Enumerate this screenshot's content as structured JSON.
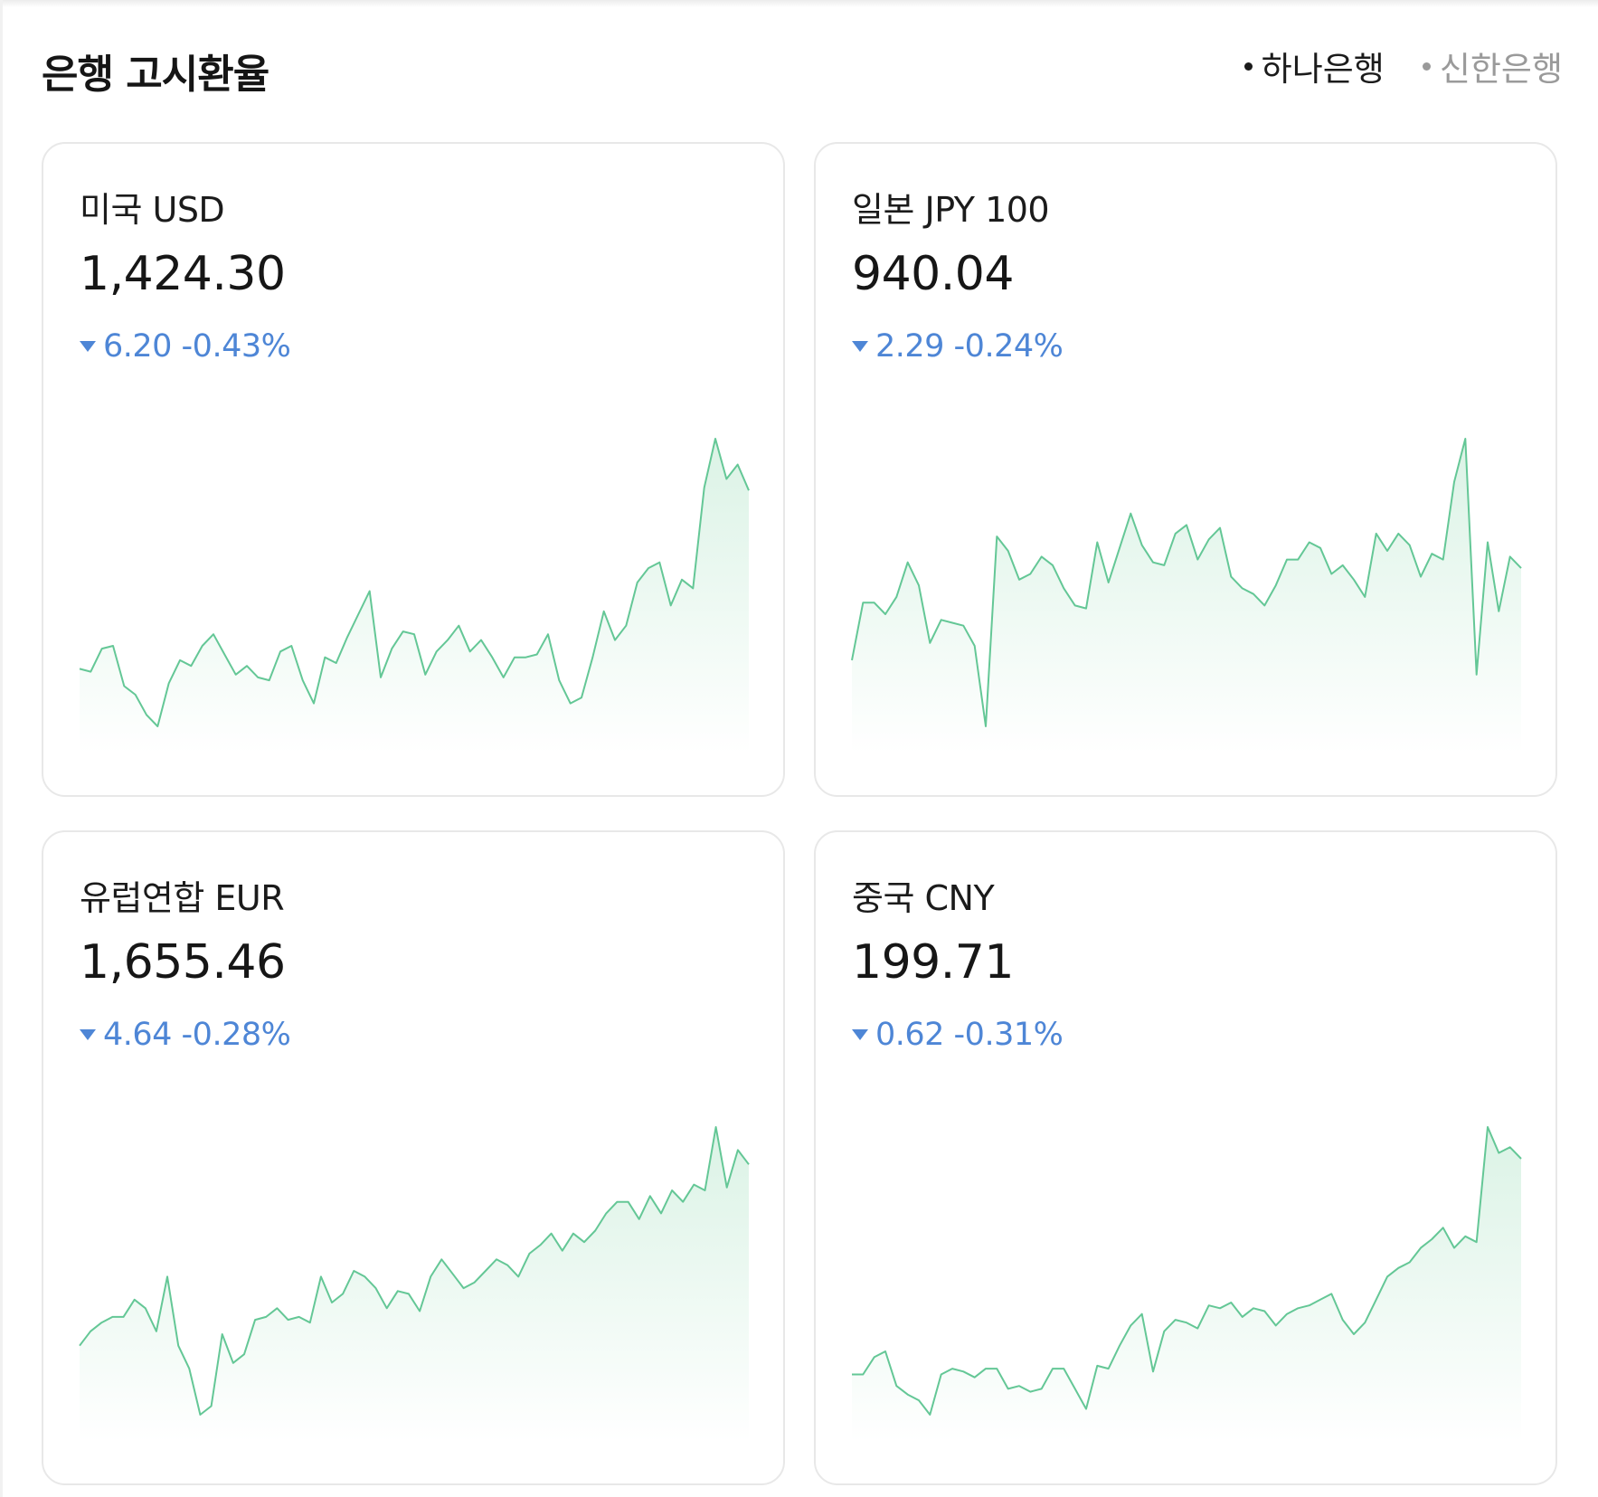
{
  "title": "은행 고시환율",
  "banks": [
    {
      "label": "하나은행",
      "active": true
    },
    {
      "label": "신한은행",
      "active": false
    }
  ],
  "colors": {
    "line": "#64c796",
    "fill": "#d9f2e4",
    "down": "#4e86d6",
    "text": "#1b1b1b",
    "inactive": "#9a9a9a"
  },
  "icons": {
    "bullet": "dot-icon",
    "direction": "triangle-down-icon"
  },
  "cards": [
    {
      "name": "미국 USD",
      "rate": "1,424.30",
      "direction": "down",
      "change": "6.20 -0.43%",
      "chart_data": {
        "type": "area",
        "values": [
          0.2,
          0.19,
          0.27,
          0.28,
          0.14,
          0.11,
          0.04,
          0.0,
          0.15,
          0.23,
          0.21,
          0.28,
          0.32,
          0.25,
          0.18,
          0.21,
          0.17,
          0.16,
          0.26,
          0.28,
          0.16,
          0.08,
          0.24,
          0.22,
          0.31,
          0.39,
          0.47,
          0.17,
          0.27,
          0.33,
          0.32,
          0.18,
          0.26,
          0.3,
          0.35,
          0.26,
          0.3,
          0.24,
          0.17,
          0.24,
          0.24,
          0.25,
          0.32,
          0.16,
          0.08,
          0.1,
          0.24,
          0.4,
          0.3,
          0.35,
          0.5,
          0.55,
          0.57,
          0.42,
          0.51,
          0.48,
          0.83,
          1.0,
          0.86,
          0.91,
          0.82
        ]
      }
    },
    {
      "name": "일본 JPY 100",
      "rate": "940.04",
      "direction": "down",
      "change": "2.29 -0.24%",
      "chart_data": {
        "type": "area",
        "values": [
          0.23,
          0.43,
          0.43,
          0.39,
          0.45,
          0.57,
          0.49,
          0.29,
          0.37,
          0.36,
          0.35,
          0.28,
          0.0,
          0.66,
          0.61,
          0.51,
          0.53,
          0.59,
          0.56,
          0.48,
          0.42,
          0.41,
          0.64,
          0.5,
          0.62,
          0.74,
          0.63,
          0.57,
          0.56,
          0.67,
          0.7,
          0.58,
          0.65,
          0.69,
          0.52,
          0.48,
          0.46,
          0.42,
          0.49,
          0.58,
          0.58,
          0.64,
          0.62,
          0.53,
          0.56,
          0.51,
          0.45,
          0.67,
          0.61,
          0.67,
          0.63,
          0.52,
          0.6,
          0.58,
          0.85,
          1.0,
          0.18,
          0.64,
          0.4,
          0.59,
          0.55
        ]
      }
    },
    {
      "name": "유럽연합 EUR",
      "rate": "1,655.46",
      "direction": "down",
      "change": "4.64 -0.28%",
      "chart_data": {
        "type": "area",
        "values": [
          0.24,
          0.29,
          0.32,
          0.34,
          0.34,
          0.4,
          0.37,
          0.29,
          0.48,
          0.24,
          0.16,
          0.0,
          0.03,
          0.28,
          0.18,
          0.21,
          0.33,
          0.34,
          0.37,
          0.33,
          0.34,
          0.32,
          0.48,
          0.39,
          0.42,
          0.5,
          0.48,
          0.44,
          0.37,
          0.43,
          0.42,
          0.36,
          0.48,
          0.54,
          0.49,
          0.44,
          0.46,
          0.5,
          0.54,
          0.52,
          0.48,
          0.56,
          0.59,
          0.63,
          0.57,
          0.63,
          0.6,
          0.64,
          0.7,
          0.74,
          0.74,
          0.68,
          0.76,
          0.7,
          0.78,
          0.74,
          0.8,
          0.78,
          1.0,
          0.79,
          0.92,
          0.87
        ]
      }
    },
    {
      "name": "중국 CNY",
      "rate": "199.71",
      "direction": "down",
      "change": "0.62 -0.31%",
      "chart_data": {
        "type": "area",
        "values": [
          0.14,
          0.14,
          0.2,
          0.22,
          0.1,
          0.07,
          0.05,
          0.0,
          0.14,
          0.16,
          0.15,
          0.13,
          0.16,
          0.16,
          0.09,
          0.1,
          0.08,
          0.09,
          0.16,
          0.16,
          0.09,
          0.02,
          0.17,
          0.16,
          0.24,
          0.31,
          0.35,
          0.15,
          0.29,
          0.33,
          0.32,
          0.3,
          0.38,
          0.37,
          0.39,
          0.34,
          0.37,
          0.36,
          0.31,
          0.35,
          0.37,
          0.38,
          0.4,
          0.42,
          0.33,
          0.28,
          0.32,
          0.4,
          0.48,
          0.51,
          0.53,
          0.58,
          0.61,
          0.65,
          0.58,
          0.62,
          0.6,
          1.0,
          0.91,
          0.93,
          0.89
        ]
      }
    }
  ]
}
